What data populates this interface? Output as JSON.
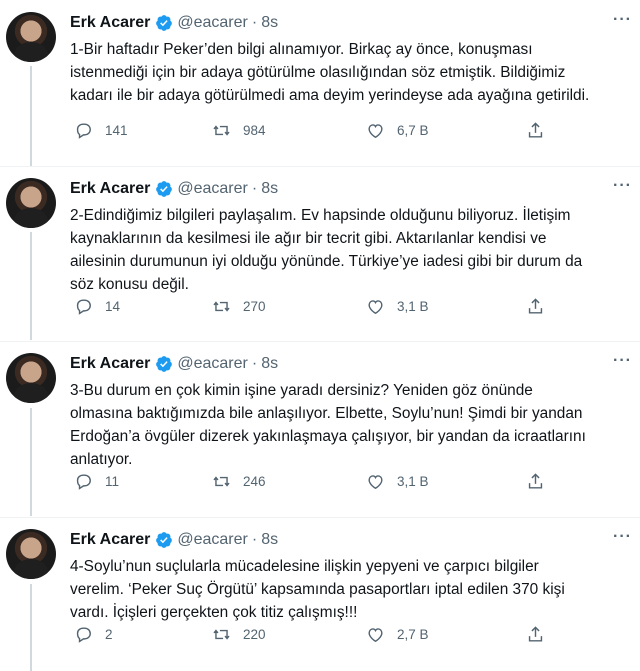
{
  "tweets": [
    {
      "name": "Erk Acarer",
      "handle": "@eacarer",
      "time": "8s",
      "text": "1-Bir haftadır Peker’den bilgi alınamıyor. Birkaç ay önce, konuşması\nistenmediği için bir adaya götürülme olasılığından söz etmiştik. Bildiğimiz\nkadarı ile bir adaya götürülmedi ama deyim yerindeyse ada ayağına getirildi.",
      "replies": "141",
      "retweets": "984",
      "likes": "6,7 B"
    },
    {
      "name": "Erk Acarer",
      "handle": "@eacarer",
      "time": "8s",
      "text": "2-Edindiğimiz bilgileri paylaşalım. Ev hapsinde olduğunu biliyoruz. İletişim\nkaynaklarının da kesilmesi ile ağır bir tecrit gibi. Aktarılanlar kendisi ve\nailesinin durumunun iyi olduğu yönünde. Türkiye’ye iadesi gibi bir durum da\nsöz konusu değil.",
      "replies": "14",
      "retweets": "270",
      "likes": "3,1 B"
    },
    {
      "name": "Erk Acarer",
      "handle": "@eacarer",
      "time": "8s",
      "text": "3-Bu durum en çok kimin işine yaradı dersiniz? Yeniden göz önünde\nolmasına baktığımızda bile anlaşılıyor. Elbette, Soylu’nun! Şimdi bir yandan\nErdoğan’a övgüler dizerek yakınlaşmaya çalışıyor, bir yandan da icraatlarını\nanlatıyor.",
      "replies": "11",
      "retweets": "246",
      "likes": "3,1 B"
    },
    {
      "name": "Erk Acarer",
      "handle": "@eacarer",
      "time": "8s",
      "text": "4-Soylu’nun suçlularla mücadelesine ilişkin yepyeni ve çarpıcı bilgiler\nverelim. ‘Peker Suç Örgütü’ kapsamında pasaportları iptal edilen 370 kişi\nvardı. İçişleri gerçekten çok titiz çalışmış!!!",
      "replies": "2",
      "retweets": "220",
      "likes": "2,7 B"
    }
  ],
  "colors": {
    "verified": "#1d9bf0",
    "secondary_text": "#536471",
    "thread_line": "#cfd9de"
  },
  "icons": [
    "verified-badge-icon",
    "more-icon",
    "reply-icon",
    "retweet-icon",
    "like-icon",
    "share-icon"
  ]
}
